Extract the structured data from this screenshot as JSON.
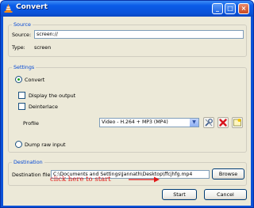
{
  "window": {
    "title": "Convert",
    "buttons": {
      "minimize": "_",
      "maximize": "□",
      "close": "×"
    }
  },
  "source": {
    "group_title": "Source",
    "source_label": "Source:",
    "source_value": "screen://",
    "type_label": "Type:",
    "type_value": "screen"
  },
  "settings": {
    "group_title": "Settings",
    "convert_label": "Convert",
    "convert_selected": true,
    "display_output_label": "Display the output",
    "display_output_checked": false,
    "deinterlace_label": "Deinterlace",
    "deinterlace_checked": false,
    "profile_label": "Profile",
    "profile_value": "Video - H.264 + MP3 (MP4)",
    "dump_raw_label": "Dump raw input",
    "dump_raw_selected": false,
    "icons": [
      "wrench-icon",
      "delete-icon",
      "new-profile-icon"
    ]
  },
  "destination": {
    "group_title": "Destination",
    "file_label": "Destination file:",
    "file_value": "C:\\Documents and Settings\\Jannath\\Desktop\\ffcjhfg.mp4",
    "browse_label": "Browse"
  },
  "annotation": {
    "text": "click here to start",
    "color": "#e01818"
  },
  "footer": {
    "start_label": "Start",
    "cancel_label": "Cancel"
  }
}
